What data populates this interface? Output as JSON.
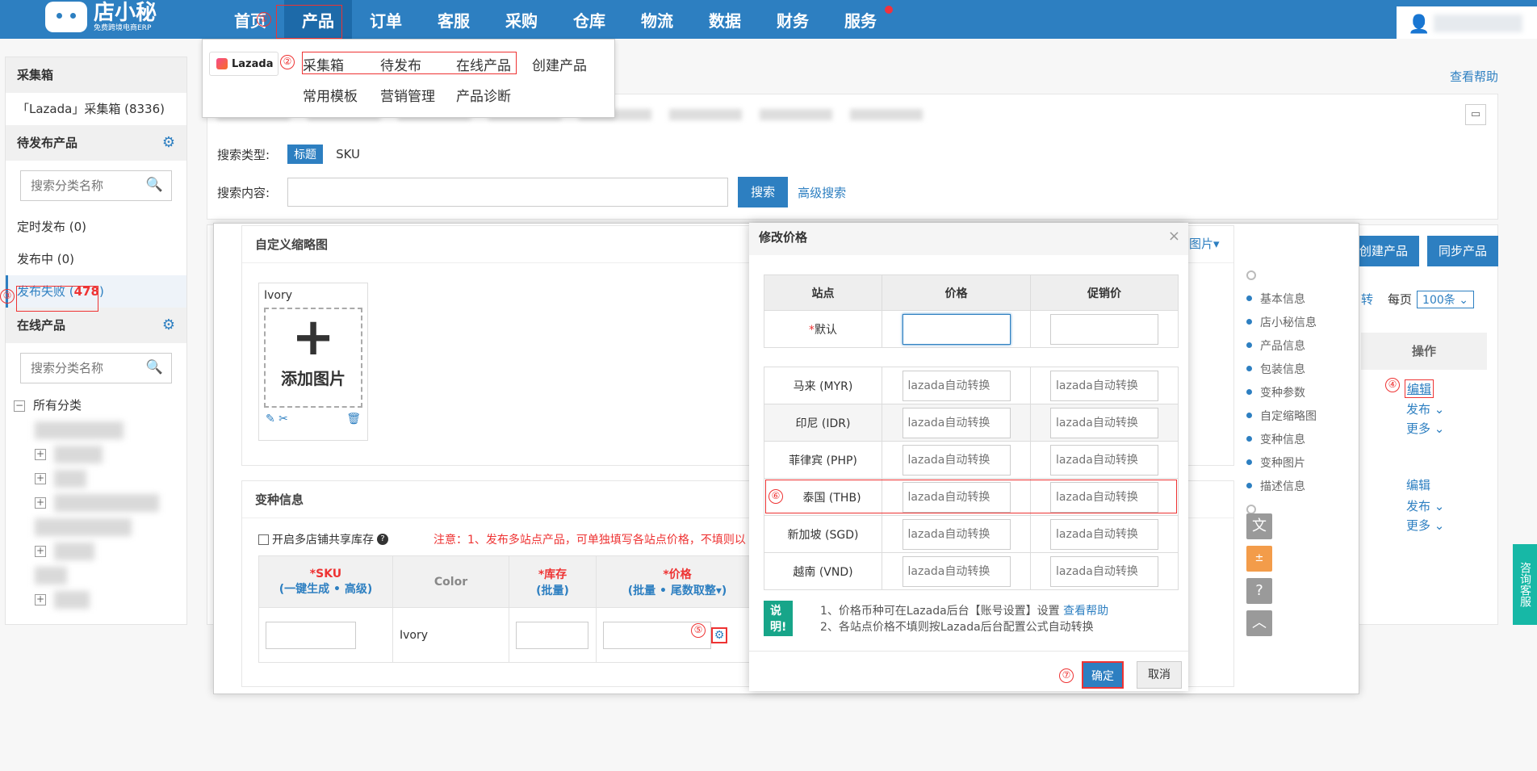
{
  "brand": {
    "name": "店小秘",
    "tagline": "免费跨境电商ERP"
  },
  "nav": {
    "items": [
      "首页",
      "产品",
      "订单",
      "客服",
      "采购",
      "仓库",
      "物流",
      "数据",
      "财务",
      "服务"
    ],
    "active": "产品"
  },
  "menu": {
    "platform": "Lazada",
    "row1": [
      "采集箱",
      "待发布",
      "在线产品",
      "创建产品"
    ],
    "row2": [
      "常用模板",
      "营销管理",
      "产品诊断"
    ]
  },
  "sidebar": {
    "collect_head": "采集箱",
    "collect_item": "「Lazada」采集箱 (8336)",
    "pending_head": "待发布产品",
    "search_placeholder": "搜索分类名称",
    "scheduled": "定时发布 (0)",
    "publishing": "发布中 (0)",
    "failed_label": "发布失败 (",
    "failed_count": "478",
    "failed_close": ")",
    "online_head": "在线产品",
    "all_categories": "所有分类"
  },
  "main": {
    "help": "查看帮助",
    "search_type_label": "搜索类型:",
    "search_type_title": "标题",
    "search_type_sku": "SKU",
    "search_content_label": "搜索内容:",
    "search_button": "搜索",
    "advanced_search": "高级搜索",
    "create_product": "创建产品",
    "sync_product": "同步产品",
    "per_page_label": "每页",
    "per_page_value": "100条",
    "ops_header": "操作",
    "edit": "编辑",
    "publish": "发布",
    "more": "更多",
    "partial_zhuan": "转",
    "side_float": "咨询客服"
  },
  "edit_modal": {
    "thumb_card_title": "自定义缩略图",
    "thumb_variant": "Ivory",
    "add_image": "添加图片",
    "variant_card_title": "变种信息",
    "share_stock": "开启多店铺共享库存",
    "notice": "注意：1、发布多站点产品，可单独填写各站点价格，不填则以",
    "col_sku": "SKU",
    "col_sku_sub_a": "一键生成",
    "col_sku_sub_b": "高级",
    "col_color": "Color",
    "col_stock": "库存",
    "col_stock_sub": "批量",
    "col_price": "价格",
    "col_price_sub_a": "批量",
    "col_price_sub_b": "尾数取整",
    "row_color": "Ivory",
    "image_suffix": "图片"
  },
  "steps": [
    "基本信息",
    "店小秘信息",
    "产品信息",
    "包装信息",
    "变种参数",
    "自定缩略图",
    "变种信息",
    "变种图片",
    "描述信息"
  ],
  "price_modal": {
    "title": "修改价格",
    "col_site": "站点",
    "col_price": "价格",
    "col_promo": "促销价",
    "default_label": "默认",
    "auto_placeholder": "lazada自动转换",
    "sites": [
      "马来 (MYR)",
      "印尼 (IDR)",
      "菲律宾 (PHP)",
      "泰国 (THB)",
      "新加坡 (SGD)",
      "越南 (VND)"
    ],
    "note_tag": "说明!",
    "note1": "1、价格币种可在Lazada后台【账号设置】设置",
    "note1_link": "查看帮助",
    "note2": "2、各站点价格不填则按Lazada后台配置公式自动转换",
    "ok": "确定",
    "cancel": "取消"
  },
  "annotations": [
    "①",
    "②",
    "③",
    "④",
    "⑤",
    "⑥",
    "⑦"
  ],
  "colors": {
    "primary": "#2d7fc1",
    "annotation": "#e33333",
    "note": "#17a589"
  }
}
